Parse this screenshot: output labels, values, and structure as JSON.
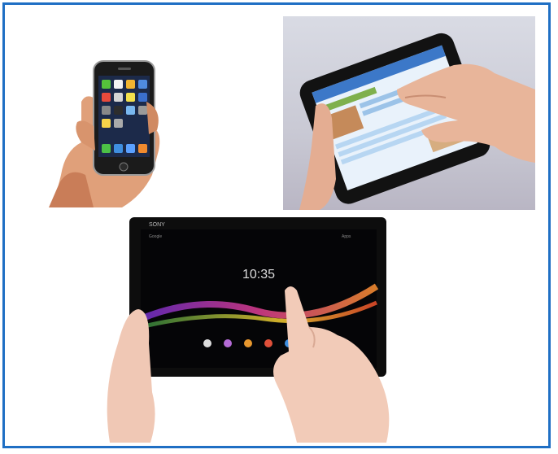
{
  "sony_screen": {
    "brand": "SONY",
    "clock": "10:35",
    "search_label": "Google",
    "apps_label": "Apps"
  },
  "colors": {
    "border": "#1f6fc4",
    "background": "#ffffff"
  }
}
